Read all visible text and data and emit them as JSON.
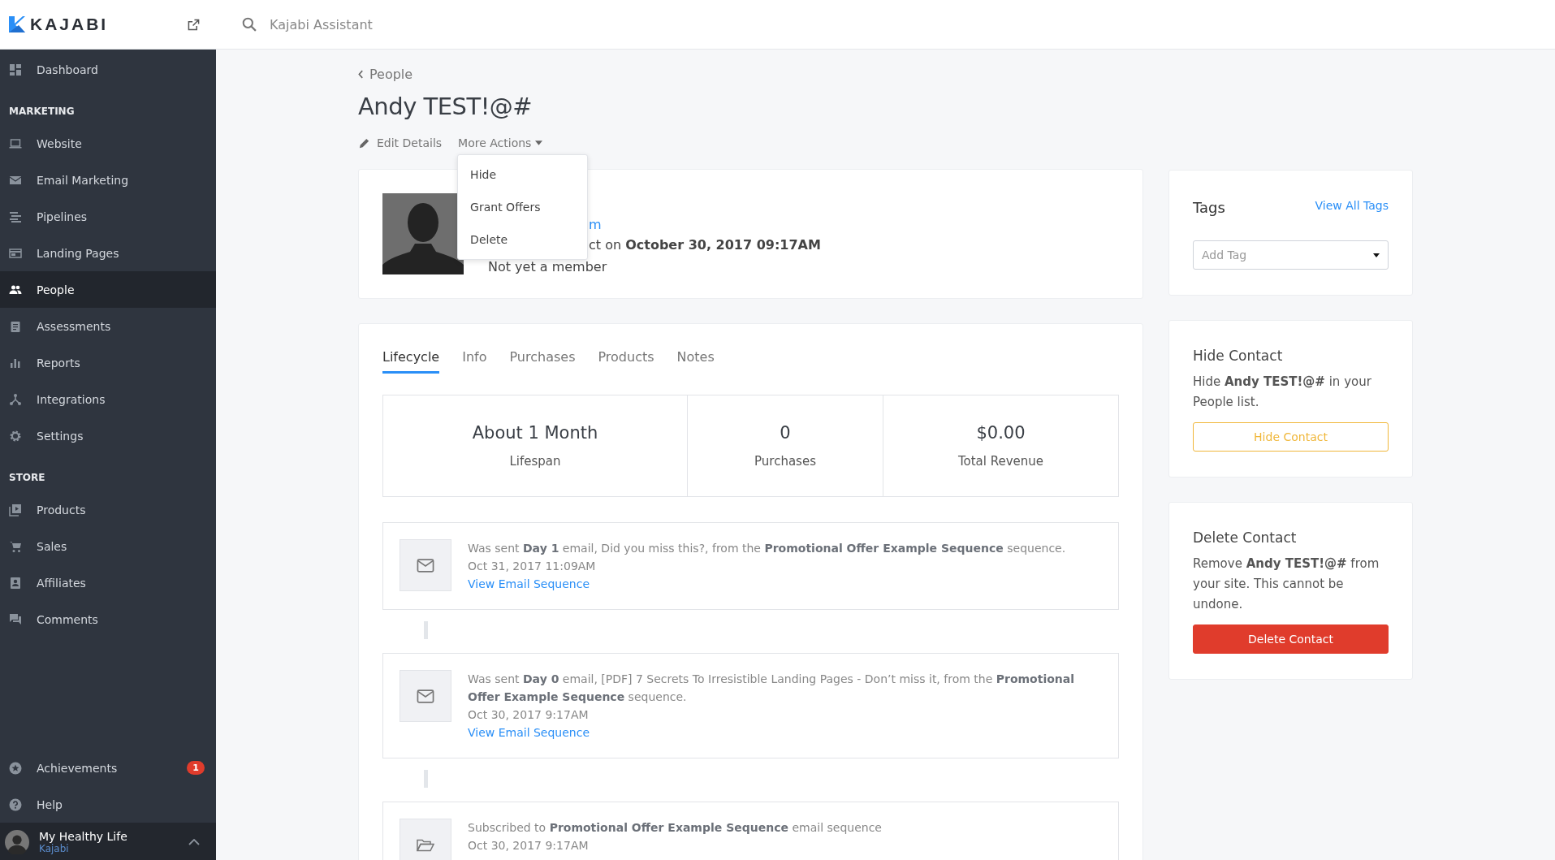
{
  "header": {
    "logo": "KAJABI",
    "search": {
      "placeholder": "Kajabi Assistant"
    }
  },
  "sidebar": {
    "top_items": [
      {
        "label": "Dashboard",
        "selected": false
      }
    ],
    "sections": [
      {
        "heading": "MARKETING",
        "items": [
          {
            "label": "Website",
            "selected": false
          },
          {
            "label": "Email Marketing",
            "selected": false
          },
          {
            "label": "Pipelines",
            "selected": false
          },
          {
            "label": "Landing Pages",
            "selected": false
          },
          {
            "label": "People",
            "selected": true
          },
          {
            "label": "Assessments",
            "selected": false
          },
          {
            "label": "Reports",
            "selected": false
          },
          {
            "label": "Integrations",
            "selected": false
          },
          {
            "label": "Settings",
            "selected": false
          }
        ]
      },
      {
        "heading": "STORE",
        "items": [
          {
            "label": "Products",
            "selected": false
          },
          {
            "label": "Sales",
            "selected": false
          },
          {
            "label": "Affiliates",
            "selected": false
          },
          {
            "label": "Comments",
            "selected": false
          }
        ]
      }
    ],
    "bottom_items": [
      {
        "label": "Achievements",
        "badge": "1"
      },
      {
        "label": "Help"
      }
    ],
    "account": {
      "name": "My Healthy Life",
      "subtitle": "Kajabi"
    }
  },
  "breadcrumb": "People",
  "title": "Andy TEST!@#",
  "actions": [
    {
      "label": "Edit Details",
      "kind": "edit"
    },
    {
      "label": "More Actions",
      "kind": "menu"
    }
  ],
  "dropdown": {
    "items": [
      "Hide",
      "Grant Offers",
      "Delete"
    ]
  },
  "profile": {
    "email_fragment": "m",
    "joined_fragment": "ct on **October 30, 2017 09:17AM**",
    "membership": "Not yet a member"
  },
  "tabs": [
    {
      "label": "Lifecycle",
      "selected": true
    },
    {
      "label": "Info",
      "selected": false
    },
    {
      "label": "Purchases",
      "selected": false
    },
    {
      "label": "Products",
      "selected": false
    },
    {
      "label": "Notes",
      "selected": false
    }
  ],
  "stats": [
    {
      "value": "About 1 Month",
      "label": "Lifespan"
    },
    {
      "value": "0",
      "label": "Purchases"
    },
    {
      "value": "$0.00",
      "label": "Total Revenue"
    }
  ],
  "activity": [
    {
      "kind": "email",
      "text": "Was sent **Day 1** email, Did you miss this?, from the **Promotional Offer Example Sequence** sequence.",
      "date": "Oct 31, 2017 11:09AM",
      "link": "View Email Sequence"
    },
    {
      "kind": "email",
      "text": "Was sent **Day 0** email, [PDF] 7 Secrets To Irresistible Landing Pages - Don’t miss it, from the **Promotional Offer Example Sequence** sequence.",
      "date": "Oct 30, 2017 9:17AM",
      "link": "View Email Sequence"
    },
    {
      "kind": "subscription",
      "text": "Subscribed to **Promotional Offer Example Sequence** email sequence",
      "date": "Oct 30, 2017 9:17AM"
    }
  ],
  "tags": {
    "title": "Tags",
    "link": "View All Tags",
    "select": {
      "placeholder": "Add Tag"
    }
  },
  "hide_contact": {
    "title": "Hide Contact",
    "text": "Hide **Andy TEST!@#** in your People list.",
    "button": "Hide Contact"
  },
  "delete_contact": {
    "title": "Delete Contact",
    "text": "Remove **Andy TEST!@#** from your site. This cannot be undone.",
    "button": "Delete Contact"
  }
}
